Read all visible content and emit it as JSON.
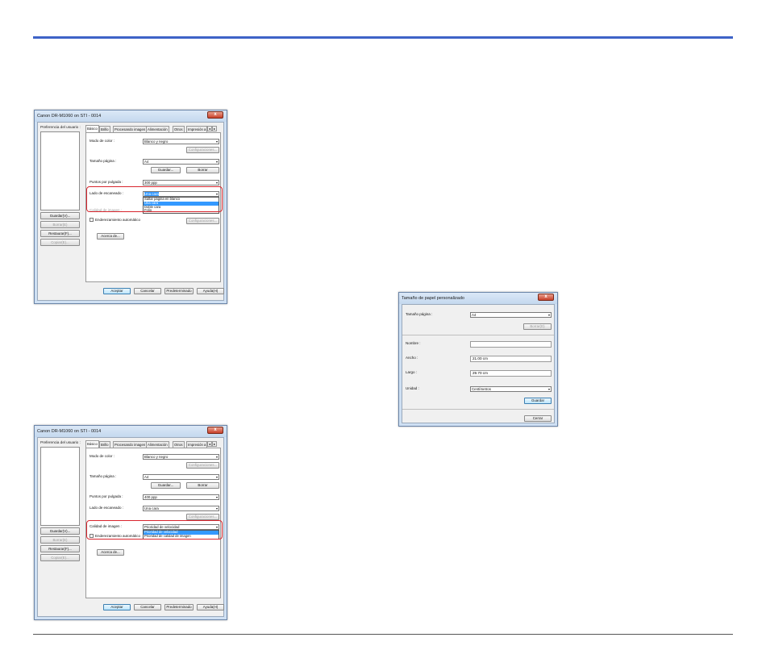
{
  "driver": {
    "title": "Canon DR-M1060 on STI - 0014",
    "close": "x",
    "left": {
      "user_pref_label": "Preferencia del usuario :",
      "save_btn": "Guardar(V)...",
      "delete_btn": "Borrar(E)",
      "restore_btn": "Restaurar(F)...",
      "copy_btn": "Copiar(E)..."
    },
    "tabs": [
      "Básico",
      "Brillo",
      "Procesando imagen",
      "Alimentación",
      "Otros",
      "Impresión a"
    ],
    "tab_arrows": [
      "◂",
      "▸"
    ],
    "labels": {
      "color_mode": "Modo de color :",
      "page_size": "Tamaño página :",
      "dpi": "Puntos por pulgada :",
      "scan_side": "Lado de escaneado :",
      "image_quality": "Calidad de imagen :",
      "deskew": "Enderezamiento automático"
    },
    "buttons": {
      "settings": "Configuraciones...",
      "save": "Guardar...",
      "delete": "Borrar",
      "about": "Acerca de...",
      "ok": "Aceptar",
      "cancel": "Cancelar",
      "defaults": "Predeterminado",
      "help": "Ayuda(H)"
    },
    "color_mode_value": "Blanco y negro",
    "page_size_value": "A4",
    "arrow": "▾"
  },
  "win1": {
    "dpi_value": "300 ppp",
    "scan_side_value": "Una cara",
    "scan_side_options": [
      "Saltar página en blanco",
      "Una cara",
      "Doble cara",
      "Folio"
    ],
    "scan_side_selected": 1
  },
  "win2": {
    "dpi_value": "400 ppp",
    "scan_side_value": "Una cara",
    "quality_value": "Prioridad de velocidad",
    "quality_options": [
      "Prioridad de velocidad",
      "Prioridad de calidad de imagen"
    ],
    "quality_selected": 0
  },
  "paper_dialog": {
    "title": "Tamaño de papel personalizado",
    "close": "x",
    "page_size_label": "Tamaño página :",
    "page_size_value": "A4",
    "delete_btn": "Borrar(D)",
    "name_label": "Nombre :",
    "name_value": "",
    "width_label": "Ancho :",
    "width_value": "21.00 cm",
    "length_label": "Largo :",
    "length_value": "29.70 cm",
    "unit_label": "Unidad :",
    "unit_value": "Centímetros",
    "save_btn": "Guardar",
    "close_btn": "Cerrar",
    "arrow": "▾"
  }
}
